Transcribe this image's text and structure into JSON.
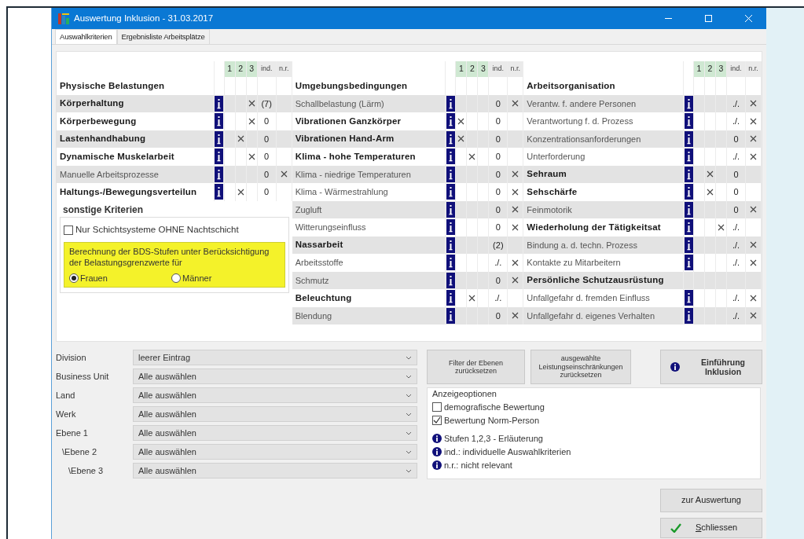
{
  "window": {
    "title": "Auswertung Inklusion - 31.03.2017"
  },
  "tabs": [
    {
      "label": "Auswahlkriterien",
      "selected": true
    },
    {
      "label": "Ergebnisliste Arbeitsplätze",
      "selected": false
    }
  ],
  "tables": [
    {
      "headers": [
        "1",
        "2",
        "3",
        "ind.",
        "n.r."
      ],
      "rows": [
        {
          "label": "Physische Belastungen",
          "kind": "heading"
        },
        {
          "label": "Körperhaltung",
          "kind": "criterion",
          "bold": true,
          "stage_1": false,
          "stage_2": false,
          "stage_3": true,
          "ind": "(7)",
          "not_relevant": false
        },
        {
          "label": "Körperbewegung",
          "kind": "criterion",
          "bold": true,
          "stage_1": false,
          "stage_2": false,
          "stage_3": true,
          "ind": "0",
          "not_relevant": false
        },
        {
          "label": "Lastenhandhabung",
          "kind": "criterion",
          "bold": true,
          "stage_1": false,
          "stage_2": true,
          "stage_3": false,
          "ind": "0",
          "not_relevant": false
        },
        {
          "label": "Dynamische Muskelarbeit",
          "kind": "criterion",
          "bold": true,
          "stage_1": false,
          "stage_2": false,
          "stage_3": true,
          "ind": "0",
          "not_relevant": false
        },
        {
          "label": "Manuelle Arbeitsprozesse",
          "kind": "criterion",
          "bold": false,
          "stage_1": false,
          "stage_2": false,
          "stage_3": false,
          "ind": "0",
          "not_relevant": true
        },
        {
          "label": "Haltungs-/Bewegungsverteilun",
          "kind": "criterion",
          "bold": true,
          "stage_1": false,
          "stage_2": true,
          "stage_3": false,
          "ind": "0",
          "not_relevant": false
        }
      ],
      "other_criteria": {
        "title": "sonstige Kriterien",
        "checkbox": {
          "label": "Nur Schichtsysteme OHNE Nachtschicht",
          "checked": false
        },
        "note": "Berechnung der BDS-Stufen unter Berücksichtigung der Belastungsgrenzwerte für",
        "radios": [
          {
            "label": "Frauen",
            "selected": true
          },
          {
            "label": "Männer",
            "selected": false
          }
        ]
      }
    },
    {
      "headers": [
        "1",
        "2",
        "3",
        "ind.",
        "n.r."
      ],
      "rows": [
        {
          "label": "Umgebungsbedingungen",
          "kind": "heading"
        },
        {
          "label": "Schallbelastung (Lärm)",
          "kind": "criterion",
          "bold": false,
          "stage_1": false,
          "stage_2": false,
          "stage_3": false,
          "ind": "0",
          "not_relevant": true
        },
        {
          "label": "Vibrationen Ganzkörper",
          "kind": "criterion",
          "bold": true,
          "stage_1": true,
          "stage_2": false,
          "stage_3": false,
          "ind": "0",
          "not_relevant": false
        },
        {
          "label": "Vibrationen Hand-Arm",
          "kind": "criterion",
          "bold": true,
          "stage_1": true,
          "stage_2": false,
          "stage_3": false,
          "ind": "0",
          "not_relevant": false
        },
        {
          "label": "Klima - hohe Temperaturen",
          "kind": "criterion",
          "bold": true,
          "stage_1": false,
          "stage_2": true,
          "stage_3": false,
          "ind": "0",
          "not_relevant": false
        },
        {
          "label": "Klima - niedrige Temperaturen",
          "kind": "criterion",
          "bold": false,
          "stage_1": false,
          "stage_2": false,
          "stage_3": false,
          "ind": "0",
          "not_relevant": true
        },
        {
          "label": "Klima - Wärmestrahlung",
          "kind": "criterion",
          "bold": false,
          "stage_1": false,
          "stage_2": false,
          "stage_3": false,
          "ind": "0",
          "not_relevant": true
        },
        {
          "label": "Zugluft",
          "kind": "criterion",
          "bold": false,
          "stage_1": false,
          "stage_2": false,
          "stage_3": false,
          "ind": "0",
          "not_relevant": true
        },
        {
          "label": "Witterungseinfluss",
          "kind": "criterion",
          "bold": false,
          "stage_1": false,
          "stage_2": false,
          "stage_3": false,
          "ind": "0",
          "not_relevant": true
        },
        {
          "label": "Nassarbeit",
          "kind": "criterion",
          "bold": true,
          "stage_1": false,
          "stage_2": false,
          "stage_3": false,
          "ind": "(2)",
          "not_relevant": false
        },
        {
          "label": "Arbeitsstoffe",
          "kind": "criterion",
          "bold": false,
          "stage_1": false,
          "stage_2": false,
          "stage_3": false,
          "ind": "./.",
          "not_relevant": true
        },
        {
          "label": "Schmutz",
          "kind": "criterion",
          "bold": false,
          "stage_1": false,
          "stage_2": false,
          "stage_3": false,
          "ind": "0",
          "not_relevant": true
        },
        {
          "label": "Beleuchtung",
          "kind": "criterion",
          "bold": true,
          "stage_1": false,
          "stage_2": true,
          "stage_3": false,
          "ind": "./.",
          "not_relevant": false
        },
        {
          "label": "Blendung",
          "kind": "criterion",
          "bold": false,
          "stage_1": false,
          "stage_2": false,
          "stage_3": false,
          "ind": "0",
          "not_relevant": true
        }
      ]
    },
    {
      "headers": [
        "1",
        "2",
        "3",
        "ind.",
        "n.r."
      ],
      "rows": [
        {
          "label": "Arbeitsorganisation",
          "kind": "heading"
        },
        {
          "label": "Verantw. f. andere Personen",
          "kind": "criterion",
          "bold": false,
          "stage_1": false,
          "stage_2": false,
          "stage_3": false,
          "ind": "./.",
          "not_relevant": true
        },
        {
          "label": "Verantwortung f. d. Prozess",
          "kind": "criterion",
          "bold": false,
          "stage_1": false,
          "stage_2": false,
          "stage_3": false,
          "ind": "./.",
          "not_relevant": true
        },
        {
          "label": "Konzentrationsanforderungen",
          "kind": "criterion",
          "bold": false,
          "stage_1": false,
          "stage_2": false,
          "stage_3": false,
          "ind": "0",
          "not_relevant": true
        },
        {
          "label": "Unterforderung",
          "kind": "criterion",
          "bold": false,
          "stage_1": false,
          "stage_2": false,
          "stage_3": false,
          "ind": "./.",
          "not_relevant": true
        },
        {
          "label": "Sehraum",
          "kind": "criterion",
          "bold": true,
          "stage_1": false,
          "stage_2": true,
          "stage_3": false,
          "ind": "0",
          "not_relevant": false
        },
        {
          "label": "Sehschärfe",
          "kind": "criterion",
          "bold": true,
          "stage_1": false,
          "stage_2": true,
          "stage_3": false,
          "ind": "0",
          "not_relevant": false
        },
        {
          "label": "Feinmotorik",
          "kind": "criterion",
          "bold": false,
          "stage_1": false,
          "stage_2": false,
          "stage_3": false,
          "ind": "0",
          "not_relevant": true
        },
        {
          "label": "Wiederholung der Tätigkeitsat",
          "kind": "criterion",
          "bold": true,
          "stage_1": false,
          "stage_2": false,
          "stage_3": true,
          "ind": "./.",
          "not_relevant": false
        },
        {
          "label": "Bindung a. d. techn. Prozess",
          "kind": "criterion",
          "bold": false,
          "stage_1": false,
          "stage_2": false,
          "stage_3": false,
          "ind": "./.",
          "not_relevant": true
        },
        {
          "label": "Kontakte zu Mitarbeitern",
          "kind": "criterion",
          "bold": false,
          "stage_1": false,
          "stage_2": false,
          "stage_3": false,
          "ind": "./.",
          "not_relevant": true
        },
        {
          "label": "Persönliche Schutzausrüstung",
          "kind": "heading"
        },
        {
          "label": "Unfallgefahr d. fremden Einfluss",
          "kind": "criterion",
          "bold": false,
          "stage_1": false,
          "stage_2": false,
          "stage_3": false,
          "ind": "./.",
          "not_relevant": true
        },
        {
          "label": "Unfallgefahr d. eigenes Verhalten",
          "kind": "criterion",
          "bold": false,
          "stage_1": false,
          "stage_2": false,
          "stage_3": false,
          "ind": "./.",
          "not_relevant": true
        }
      ]
    }
  ],
  "filters": [
    {
      "label": "Division",
      "value": "leerer Eintrag"
    },
    {
      "label": "Business Unit",
      "value": "Alle auswählen"
    },
    {
      "label": "Land",
      "value": "Alle auswählen"
    },
    {
      "label": "Werk",
      "value": "Alle auswählen"
    },
    {
      "label": "Ebene 1",
      "value": "Alle auswählen",
      "children": [
        {
          "label": "\\Ebene 2",
          "value": "Alle auswählen",
          "children": [
            {
              "label": "\\Ebene 3",
              "value": "Alle auswählen"
            }
          ]
        }
      ]
    }
  ],
  "reset_buttons": [
    {
      "label": "Filter der Ebenen zurücksetzen"
    },
    {
      "label": "ausgewählte Leistungseinschränkungen zurücksetzen"
    }
  ],
  "intro_button": {
    "label": "Einführung Inklusion"
  },
  "display_options": {
    "title": "Anzeigeoptionen",
    "checkboxes": [
      {
        "label": "demografische Bewertung",
        "checked": false
      },
      {
        "label": "Bewertung Norm-Person",
        "checked": true
      }
    ],
    "info_links": [
      "Stufen 1,2,3 - Erläuterung",
      "ind.: individuelle Auswahlkriterien",
      "n.r.: nicht relevant"
    ]
  },
  "actions": [
    {
      "label": "zur Auswertung",
      "kind": "plain"
    },
    {
      "label": "Schliessen",
      "kind": "confirm"
    }
  ]
}
